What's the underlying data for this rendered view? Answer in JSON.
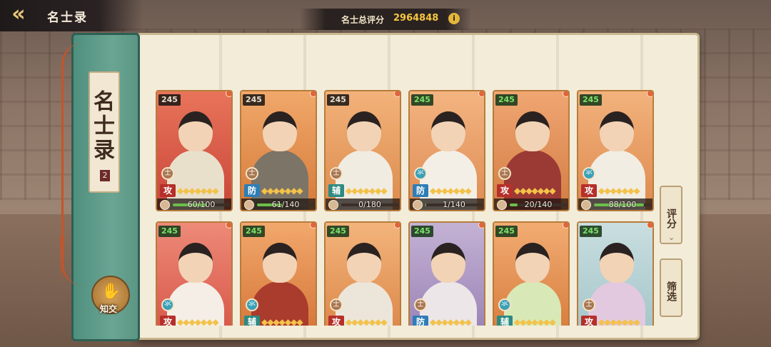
{
  "header": {
    "title": "名士录",
    "score_label": "名士总评分",
    "score_value": "2964848"
  },
  "book": {
    "label": "名士录",
    "seal": "2",
    "friend_label": "知交"
  },
  "side_buttons": {
    "sort": "评分",
    "filter": "筛选"
  },
  "cards": [
    {
      "level": "245",
      "level_color": "dark",
      "role": "攻",
      "role_color": "red",
      "faction": "士",
      "faction_color": "brown",
      "progress": "60/100",
      "fill": 0.6,
      "bg": [
        "#e8745a",
        "#c9453a"
      ],
      "robe": "#e9e0cc"
    },
    {
      "level": "245",
      "level_color": "dark",
      "role": "防",
      "role_color": "blue",
      "faction": "士",
      "faction_color": "brown",
      "progress": "61/140",
      "fill": 0.44,
      "bg": [
        "#f0a86a",
        "#d67a3a"
      ],
      "robe": "#7c7466"
    },
    {
      "level": "245",
      "level_color": "dark",
      "role": "辅",
      "role_color": "teal",
      "faction": "士",
      "faction_color": "brown",
      "progress": "0/180",
      "fill": 0,
      "bg": [
        "#f2b27a",
        "#dc8b4c"
      ],
      "robe": "#f1ece2"
    },
    {
      "level": "245",
      "level_color": "green",
      "role": "防",
      "role_color": "blue",
      "faction": "氺",
      "faction_color": "blue",
      "progress": "1/140",
      "fill": 0.01,
      "bg": [
        "#f3b480",
        "#df8c55"
      ],
      "robe": "#f4efe6"
    },
    {
      "level": "245",
      "level_color": "green",
      "role": "攻",
      "role_color": "red",
      "faction": "士",
      "faction_color": "brown",
      "progress": "20/140",
      "fill": 0.14,
      "bg": [
        "#f0a672",
        "#d37c43"
      ],
      "robe": "#9b3a34"
    },
    {
      "level": "245",
      "level_color": "green",
      "role": "攻",
      "role_color": "red",
      "faction": "氺",
      "faction_color": "blue",
      "progress": "88/100",
      "fill": 0.88,
      "bg": [
        "#f2b27c",
        "#de8a4f"
      ],
      "robe": "#f1ede3"
    },
    {
      "level": "245",
      "level_color": "green",
      "role": "攻",
      "role_color": "red",
      "faction": "氺",
      "faction_color": "blue",
      "progress": "",
      "fill": 0,
      "bg": [
        "#ee8a78",
        "#d85a4c"
      ],
      "robe": "#f4eee6"
    },
    {
      "level": "245",
      "level_color": "green",
      "role": "辅",
      "role_color": "teal",
      "faction": "氺",
      "faction_color": "blue",
      "progress": "",
      "fill": 0,
      "bg": [
        "#f2a86c",
        "#d7793c"
      ],
      "robe": "#a93c2d"
    },
    {
      "level": "245",
      "level_color": "green",
      "role": "攻",
      "role_color": "red",
      "faction": "士",
      "faction_color": "brown",
      "progress": "",
      "fill": 0,
      "bg": [
        "#f3b47c",
        "#dd8a4c"
      ],
      "robe": "#ece6da"
    },
    {
      "level": "245",
      "level_color": "green",
      "role": "防",
      "role_color": "blue",
      "faction": "士",
      "faction_color": "brown",
      "progress": "",
      "fill": 0,
      "bg": [
        "#c4b2d4",
        "#9c86b8"
      ],
      "robe": "#ece6e8"
    },
    {
      "level": "245",
      "level_color": "green",
      "role": "辅",
      "role_color": "teal",
      "faction": "氺",
      "faction_color": "blue",
      "progress": "",
      "fill": 0,
      "bg": [
        "#f2ac72",
        "#d97f41"
      ],
      "robe": "#d8e9b7"
    },
    {
      "level": "245",
      "level_color": "green",
      "role": "攻",
      "role_color": "red",
      "faction": "士",
      "faction_color": "brown",
      "progress": "",
      "fill": 0,
      "bg": [
        "#c9dee0",
        "#a6c7cb"
      ],
      "robe": "#e3c9df"
    }
  ]
}
